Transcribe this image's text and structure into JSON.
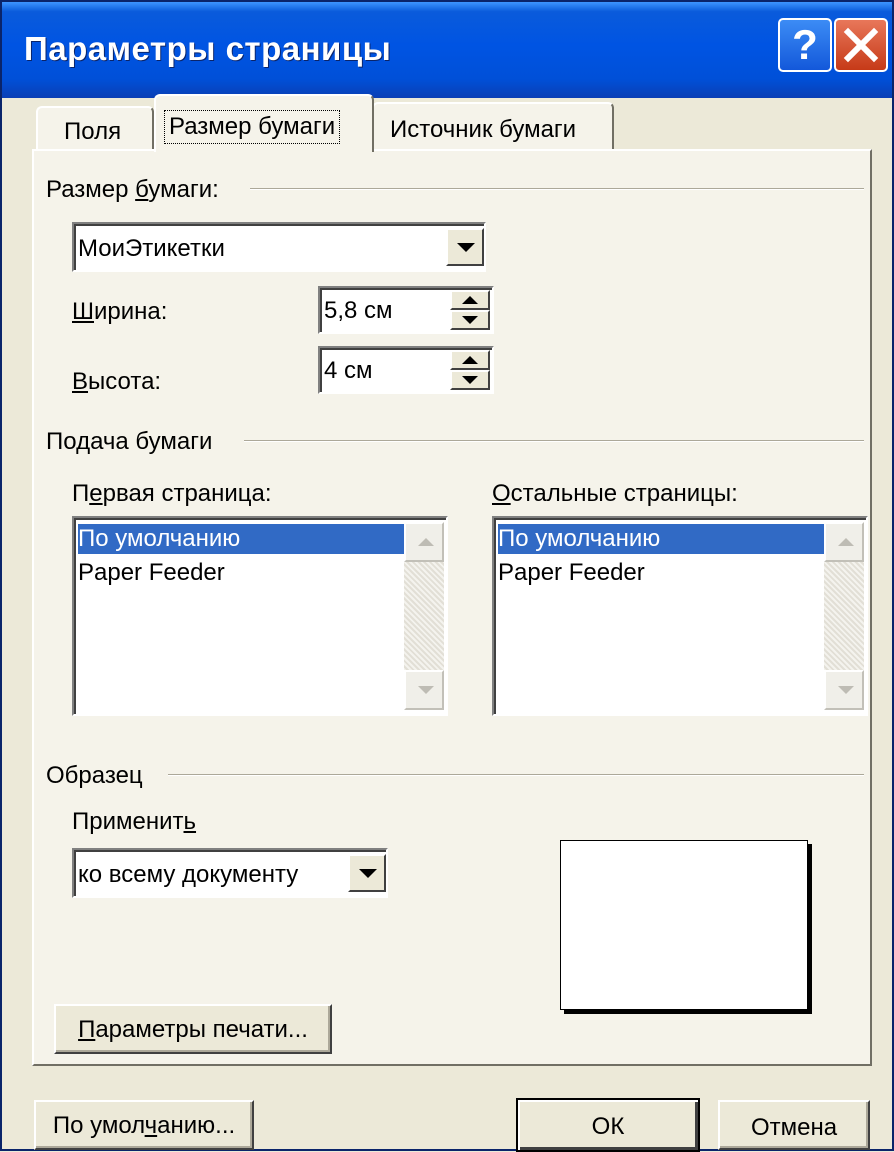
{
  "window": {
    "title": "Параметры страницы",
    "help_label": "?",
    "close_icon": "close-icon"
  },
  "tabs": [
    {
      "label": "Поля",
      "active": false
    },
    {
      "label": "Размер бумаги",
      "active": true
    },
    {
      "label": "Источник бумаги",
      "active": false
    }
  ],
  "paper_size": {
    "group_label_pre": "Размер ",
    "group_label_accel": "б",
    "group_label_post": "умаги:",
    "selected": "МоиЭтикетки",
    "width_label_accel": "Ш",
    "width_label_post": "ирина:",
    "width_value": "5,8 см",
    "height_label_accel": "В",
    "height_label_post": "ысота:",
    "height_value": "4 см"
  },
  "paper_source": {
    "group_label": "Подача бумаги",
    "first_label_pre": "П",
    "first_label_accel": "е",
    "first_label_post": "рвая страница:",
    "first_items": [
      "По умолчанию",
      "Paper Feeder"
    ],
    "first_selected": 0,
    "other_label_accel": "О",
    "other_label_post": "стальные страницы:",
    "other_items": [
      "По умолчанию",
      "Paper Feeder"
    ],
    "other_selected": 0
  },
  "preview": {
    "group_label": "Образец",
    "apply_label_pre": "Применит",
    "apply_label_accel": "ь",
    "apply_value": "ко всему документу"
  },
  "buttons": {
    "print_options": "Параметры печати...",
    "print_options_accel": "П",
    "print_options_post": "араметры печати...",
    "default_pre": "По умол",
    "default_accel": "ч",
    "default_post": "анию...",
    "ok": "ОК",
    "cancel": "Отмена"
  },
  "colors": {
    "titlebar": "#0054E3",
    "selection": "#316AC5",
    "dialog_bg": "#ECE9D8",
    "panel_bg": "#F5F3EA"
  }
}
